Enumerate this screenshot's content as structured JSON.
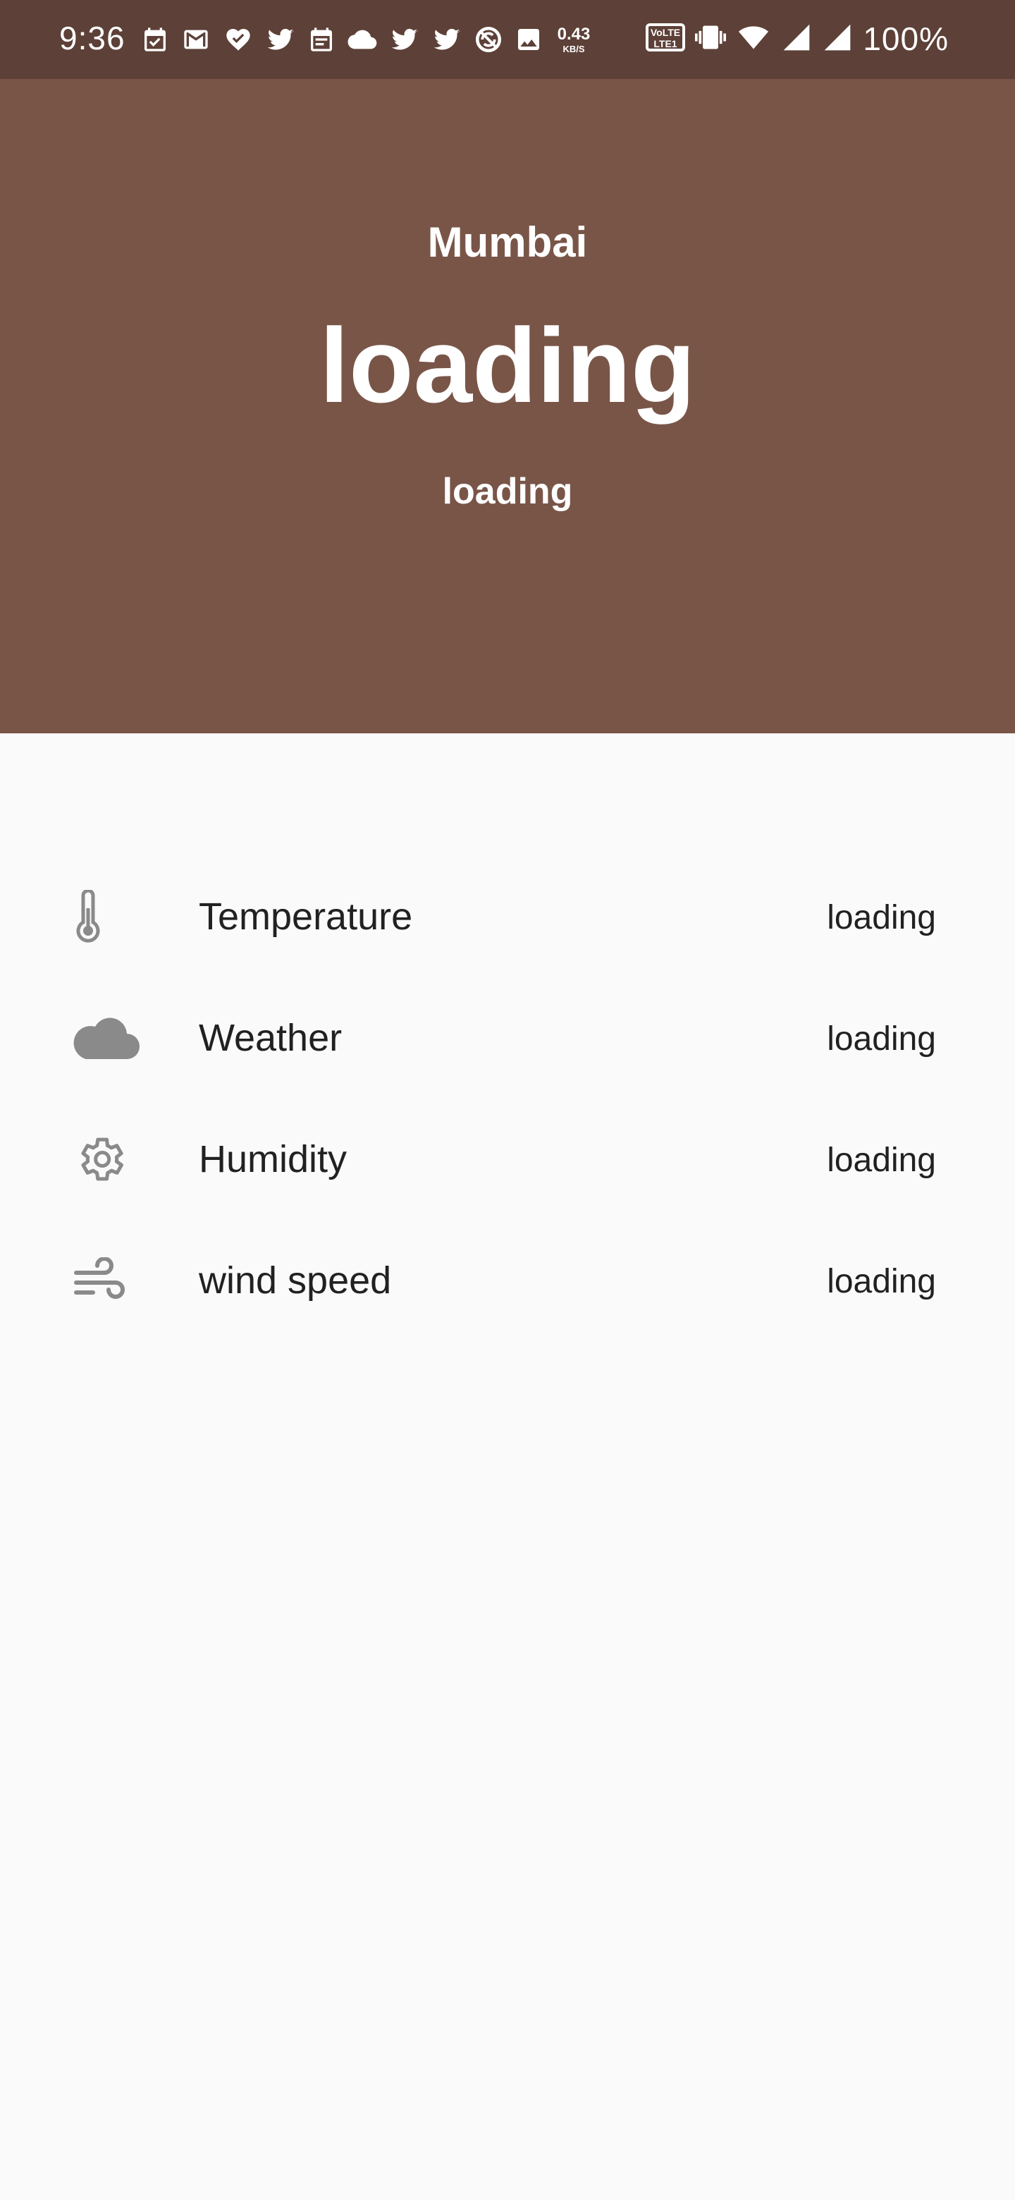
{
  "status_bar": {
    "time": "9:36",
    "net_speed_value": "0.43",
    "net_speed_unit": "KB/S",
    "battery": "100%",
    "notification_icons": [
      "calendar-check-icon",
      "gmail-icon",
      "health-icon",
      "twitter-icon",
      "calendar-icon",
      "cloud-icon",
      "twitter-icon",
      "twitter-icon",
      "sync-icon",
      "image-icon"
    ],
    "right_icons": [
      "volte-icon",
      "vibrate-icon",
      "wifi-icon",
      "signal-icon",
      "signal-icon"
    ]
  },
  "header": {
    "city": "Mumbai",
    "temperature": "loading",
    "description": "loading",
    "background_color": "#795548",
    "status_bar_color": "#5d4037"
  },
  "details": [
    {
      "icon": "thermometer-icon",
      "label": "Temperature",
      "value": "loading"
    },
    {
      "icon": "cloud-icon",
      "label": "Weather",
      "value": "loading"
    },
    {
      "icon": "gear-icon",
      "label": "Humidity",
      "value": "loading"
    },
    {
      "icon": "wind-icon",
      "label": "wind speed",
      "value": "loading"
    }
  ],
  "colors": {
    "icon_gray": "#8a8a8a",
    "text": "#212121",
    "background": "#fafafa"
  }
}
